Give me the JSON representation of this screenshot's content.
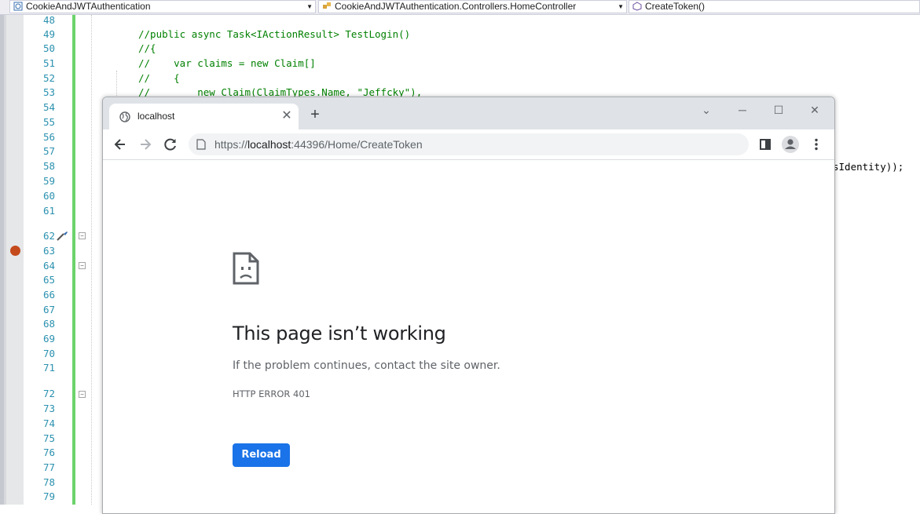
{
  "vs": {
    "nav": {
      "project": "CookieAndJWTAuthentication",
      "class": "CookieAndJWTAuthentication.Controllers.HomeController",
      "member": "CreateToken()"
    },
    "line_numbers": [
      "48",
      "49",
      "50",
      "51",
      "52",
      "53",
      "54",
      "55",
      "56",
      "57",
      "58",
      "59",
      "60",
      "61",
      "62",
      "63",
      "64",
      "65",
      "66",
      "67",
      "68",
      "69",
      "70",
      "71",
      "72",
      "73",
      "74",
      "75",
      "76",
      "77",
      "78",
      "79"
    ],
    "code_lines": [
      "//public async Task<IActionResult> TestLogin()",
      "//{",
      "//    var claims = new Claim[]",
      "//    {",
      "//        new Claim(ClaimTypes.Name, \"Jeffcky\"),"
    ],
    "code_fragment_right": "sIdentity));"
  },
  "browser": {
    "tab_title": "localhost",
    "tab_close": "✕",
    "new_tab": "+",
    "window_controls": {
      "dropdown": "⌄",
      "minimize": "─",
      "maximize": "☐",
      "close": "✕"
    },
    "url": {
      "scheme": "https://",
      "host": "localhost",
      "rest": ":44396/Home/CreateToken"
    },
    "error": {
      "title": "This page isn’t working",
      "description": "If the problem continues, contact the site owner.",
      "code": "HTTP ERROR 401",
      "reload_label": "Reload"
    },
    "colors": {
      "accent": "#1a73e8",
      "tabstrip": "#dfe3e7"
    }
  }
}
